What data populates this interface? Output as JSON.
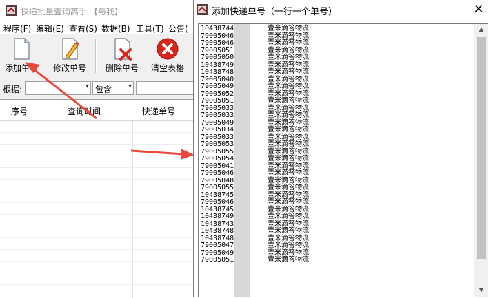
{
  "main": {
    "title": "快递批量查询高手 【与我】",
    "menu": [
      "程序(F)",
      "编辑(E)",
      "查看(S)",
      "数据(B)",
      "工具(T)",
      "公告("
    ],
    "toolbar": {
      "add": "添加单号",
      "edit": "修改单号",
      "delete": "删除单号",
      "clear": "清空表格"
    },
    "filter": {
      "label": "根据:",
      "field_value": "",
      "mode_value": "包含",
      "search_value": ""
    },
    "grid_headers": [
      "序号",
      "查询时间",
      "快递单号"
    ]
  },
  "dialog": {
    "title": "添加快递单号（一行一个单号）",
    "close_label": "✕",
    "lines": [
      {
        "num": "10438744",
        "carrier": "壹米滴答物流"
      },
      {
        "num": "79005046",
        "carrier": "壹米滴答物流"
      },
      {
        "num": "79005046",
        "carrier": "壹米滴答物流"
      },
      {
        "num": "79005051",
        "carrier": "壹米滴答物流"
      },
      {
        "num": "79005050",
        "carrier": "壹米滴答物流"
      },
      {
        "num": "10438749",
        "carrier": "壹米滴答物流"
      },
      {
        "num": "10438748",
        "carrier": "壹米滴答物流"
      },
      {
        "num": "79005040",
        "carrier": "壹米滴答物流"
      },
      {
        "num": "79005049",
        "carrier": "壹米滴答物流"
      },
      {
        "num": "79005052",
        "carrier": "壹米滴答物流"
      },
      {
        "num": "79005051",
        "carrier": "壹米滴答物流"
      },
      {
        "num": "79005033",
        "carrier": "壹米滴答物流"
      },
      {
        "num": "79005033",
        "carrier": "壹米滴答物流"
      },
      {
        "num": "79005049",
        "carrier": "壹米滴答物流"
      },
      {
        "num": "79005034",
        "carrier": "壹米滴答物流"
      },
      {
        "num": "79005033",
        "carrier": "壹米滴答物流"
      },
      {
        "num": "79005053",
        "carrier": "壹米滴答物流"
      },
      {
        "num": "79005055",
        "carrier": "壹米滴答物流"
      },
      {
        "num": "79005054",
        "carrier": "壹米滴答物流"
      },
      {
        "num": "79005041",
        "carrier": "壹米滴答物流"
      },
      {
        "num": "79005046",
        "carrier": "壹米滴答物流"
      },
      {
        "num": "79005048",
        "carrier": "壹米滴答物流"
      },
      {
        "num": "79005055",
        "carrier": "壹米滴答物流"
      },
      {
        "num": "10438745",
        "carrier": "壹米滴答物流"
      },
      {
        "num": "79005046",
        "carrier": "壹米滴答物流"
      },
      {
        "num": "10438745",
        "carrier": "壹米滴答物流"
      },
      {
        "num": "10438749",
        "carrier": "壹米滴答物流"
      },
      {
        "num": "10438743",
        "carrier": "壹米滴答物流"
      },
      {
        "num": "10438748",
        "carrier": "壹米滴答物流"
      },
      {
        "num": "10438748",
        "carrier": "壹米滴答物流"
      },
      {
        "num": "79005047",
        "carrier": "壹米滴答物流"
      },
      {
        "num": "79005049",
        "carrier": "壹米滴答物流"
      },
      {
        "num": "79005051",
        "carrier": "壹米滴答物流"
      }
    ]
  },
  "icons": {
    "app": "app-icon",
    "add": "new-document-icon",
    "edit": "pencil-document-icon",
    "delete": "delete-document-icon",
    "clear": "red-x-circle-icon",
    "arrow": "red-annotation-arrow"
  },
  "colors": {
    "arrow": "#e8473a",
    "clear_icon": "#d9261c"
  }
}
